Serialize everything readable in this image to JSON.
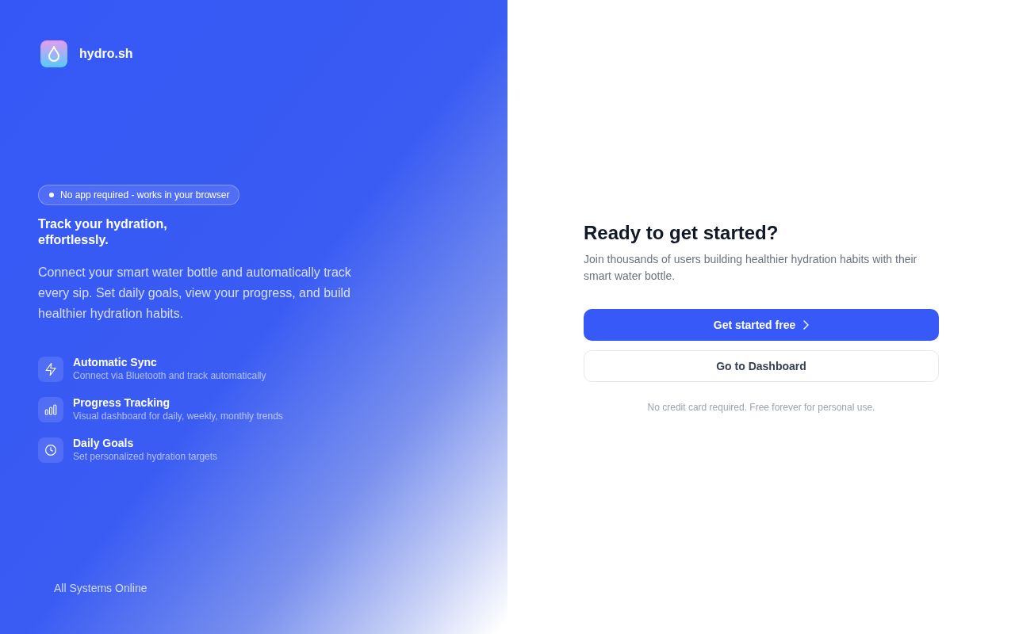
{
  "brand": {
    "name": "hydro.sh"
  },
  "hero": {
    "badge": "No app required - works in your browser",
    "title": "Track your hydration, effortlessly.",
    "description": "Connect your smart water bottle and automatically track every sip. Set daily goals, view your progress, and build healthier hydration habits."
  },
  "features": [
    {
      "kind": "sync",
      "title": "Automatic Sync",
      "description": "Connect via Bluetooth and track automatically"
    },
    {
      "kind": "tracking",
      "title": "Progress Tracking",
      "description": "Visual dashboard for daily, weekly, monthly trends"
    },
    {
      "kind": "goals",
      "title": "Daily Goals",
      "description": "Set personalized hydration targets"
    }
  ],
  "status": {
    "label": "All Systems Online"
  },
  "signup": {
    "title": "Ready to get started?",
    "description": "Join thousands of users building healthier hydration habits with their smart water bottle.",
    "primary_button": "Get started free",
    "secondary_button": "Go to Dashboard",
    "note": "No credit card required. Free forever for personal use."
  }
}
